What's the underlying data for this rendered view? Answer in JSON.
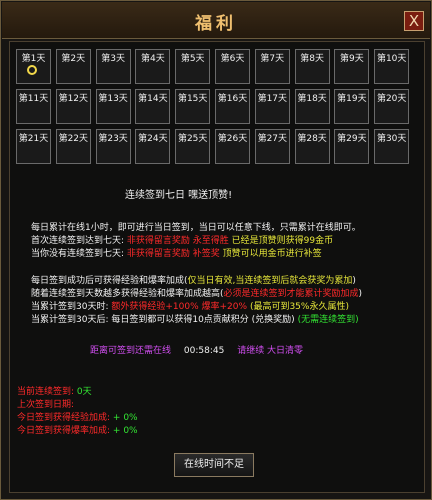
{
  "window": {
    "title": "福利",
    "close_label": "X"
  },
  "days": [
    "第1天",
    "第2天",
    "第3天",
    "第4天",
    "第5天",
    "第6天",
    "第7天",
    "第8天",
    "第9天",
    "第10天",
    "第11天",
    "第12天",
    "第13天",
    "第14天",
    "第15天",
    "第16天",
    "第17天",
    "第18天",
    "第19天",
    "第20天",
    "第21天",
    "第22天",
    "第23天",
    "第24天",
    "第25天",
    "第26天",
    "第27天",
    "第28天",
    "第29天",
    "第30天"
  ],
  "header_msg": "连续签到七日 嘿送顶赞!",
  "info": {
    "l1": "每日累计在线1小时，即可进行当日签到，当日可以任意下线，只需累计在线即可。",
    "l2a": "首次连续签到达到七天:",
    "l2b": "非获得留言奖励 永至得胜",
    "l2c": "已经是顶赞则获得99金币",
    "l3a": "当你没有连续签到七天:",
    "l3b": "非获得留言奖励 补签奖",
    "l3c": "顶赞可以用金币进行补签",
    "l4a": "每日签到成功后可获得经验和爆率加成(",
    "l4b": "仅当日有效",
    "l4c": ",当连续签到后就会获奖为累加",
    "l4d": ")",
    "l5a": "随着连续签到天数越多获得经验和爆率加成越高(",
    "l5b": "必须是连续签到才能累计奖励加成",
    "l5c": ")",
    "l6a": "当累计签到30天时:",
    "l6b": "额外获得经验+100% 爆率+20%",
    "l6c": "(最高可到35%永久属性)",
    "l7a": "当累计签到30天后: 每日签到都可以获得10点贡献积分 (兑换奖励)",
    "l7b": "(无需连续签到)"
  },
  "status": {
    "left": "距离可签到还需在线",
    "time": "00:58:45",
    "right": "请继续 大日清零"
  },
  "stats": {
    "streak_label": "当前连续签到:",
    "streak_value": "0天",
    "last_label": "上次签到日期:",
    "last_value": "",
    "exp_label": "今日签到获得经验加成:",
    "exp_value": "+ 0%",
    "drop_label": "今日签到获得爆率加成:",
    "drop_value": "+ 0%"
  },
  "button": {
    "label": "在线时间不足"
  },
  "colors": {
    "white": "#f2f2f2",
    "red": "#ff2a2a",
    "yellow": "#e6e63a",
    "green": "#33e633",
    "purple": "#d04ef0",
    "gold": "#f0c070"
  },
  "icons": {
    "today_marker": "ring-icon"
  }
}
